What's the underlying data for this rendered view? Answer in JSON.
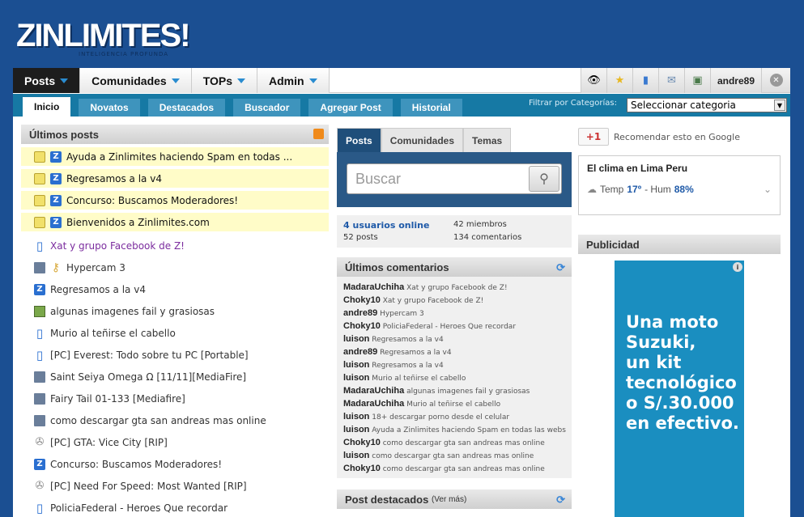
{
  "brand": {
    "logo": "ZINLIMITES!",
    "tagline": "INTELIGENCIA PROFUNDA"
  },
  "topnav": {
    "items": [
      {
        "label": "Posts"
      },
      {
        "label": "Comunidades"
      },
      {
        "label": "TOPs"
      },
      {
        "label": "Admin"
      }
    ],
    "user": "andre89"
  },
  "subnav": {
    "items": [
      "Inicio",
      "Novatos",
      "Destacados",
      "Buscador",
      "Agregar Post",
      "Historial"
    ],
    "filter_label": "Filtrar por Categorías:",
    "select_value": "Seleccionar categoria"
  },
  "posts": {
    "title": "Últimos posts",
    "sticky": [
      "Ayuda a Zinlimites haciendo Spam en todas ...",
      "Regresamos a la v4",
      "Concurso: Buscamos Moderadores!",
      "Bienvenidos a Zinlimites.com"
    ],
    "items": [
      {
        "icon": "book",
        "text": "Xat y grupo Facebook de Z!"
      },
      {
        "icon": "floppy-key",
        "text": "Hypercam 3"
      },
      {
        "icon": "z",
        "text": "Regresamos a la v4"
      },
      {
        "icon": "image",
        "text": "algunas imagenes fail y grasiosas"
      },
      {
        "icon": "book",
        "text": "Murio al teñirse el cabello"
      },
      {
        "icon": "book",
        "text": "[PC] Everest: Todo sobre tu PC [Portable]"
      },
      {
        "icon": "floppy",
        "text": "Saint Seiya Omega Ω [11/11][MediaFire]"
      },
      {
        "icon": "floppy",
        "text": "Fairy Tail 01-133 [Mediafire]"
      },
      {
        "icon": "floppy",
        "text": "como descargar gta san andreas mas online"
      },
      {
        "icon": "game",
        "text": "[PC] GTA: Vice City [RIP]"
      },
      {
        "icon": "z",
        "text": "Concurso: Buscamos Moderadores!"
      },
      {
        "icon": "game",
        "text": "[PC] Need For Speed: Most Wanted [RIP]"
      },
      {
        "icon": "book",
        "text": "PoliciaFederal - Heroes Que recordar"
      }
    ]
  },
  "search": {
    "tabs": [
      "Posts",
      "Comunidades",
      "Temas"
    ],
    "placeholder": "Buscar"
  },
  "stats": {
    "online": "4 usuarios online",
    "members": "42 miembros",
    "posts": "52 posts",
    "comments": "134 comentarios"
  },
  "comments": {
    "title": "Últimos comentarios",
    "items": [
      {
        "user": "MadaraUchiha",
        "text": "Xat y grupo Facebook de Z!"
      },
      {
        "user": "Choky10",
        "text": "Xat y grupo Facebook de Z!"
      },
      {
        "user": "andre89",
        "text": "Hypercam 3"
      },
      {
        "user": "Choky10",
        "text": "PoliciaFederal - Heroes Que recordar"
      },
      {
        "user": "luison",
        "text": "Regresamos a la v4"
      },
      {
        "user": "andre89",
        "text": "Regresamos a la v4"
      },
      {
        "user": "luison",
        "text": "Regresamos a la v4"
      },
      {
        "user": "luison",
        "text": "Murio al teñirse el cabello"
      },
      {
        "user": "MadaraUchiha",
        "text": "algunas imagenes fail y grasiosas"
      },
      {
        "user": "MadaraUchiha",
        "text": "Murio al teñirse el cabello"
      },
      {
        "user": "luison",
        "text": "18+ descargar porno desde el celular"
      },
      {
        "user": "luison",
        "text": "Ayuda a Zinlimites haciendo Spam en todas las webs"
      },
      {
        "user": "Choky10",
        "text": "como descargar gta san andreas mas online"
      },
      {
        "user": "luison",
        "text": "como descargar gta san andreas mas online"
      },
      {
        "user": "Choky10",
        "text": "como descargar gta san andreas mas online"
      }
    ]
  },
  "featured": {
    "title": "Post destacados",
    "more": "(Ver más)"
  },
  "google": {
    "button": "+1",
    "label": "Recomendar esto en Google"
  },
  "weather": {
    "title": "El clima en Lima Peru",
    "temp_label": "Temp",
    "temp": "17º",
    "sep": "- Hum",
    "hum": "88%"
  },
  "ad": {
    "title": "Publicidad",
    "lines": [
      "Una moto",
      "Suzuki,",
      "un kit",
      "tecnológico",
      "o S/.30.000",
      "en efectivo."
    ]
  }
}
